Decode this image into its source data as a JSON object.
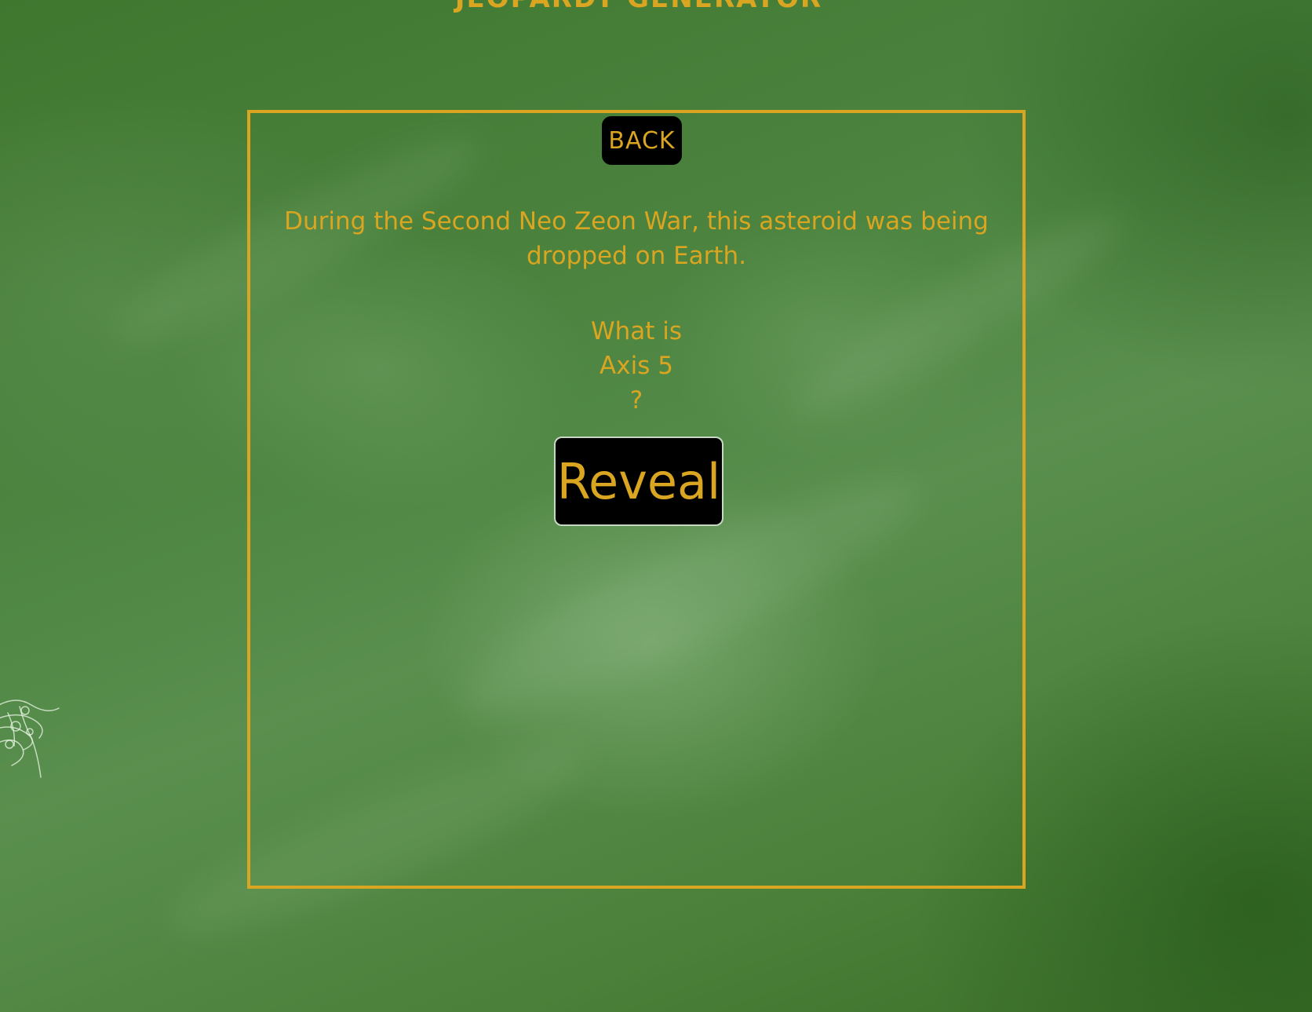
{
  "header": {
    "title": "JEOPARDY GENERATOR"
  },
  "board": {
    "back_label": "BACK",
    "clue": "During the Second Neo Zeon War, this asteroid was being dropped on Earth.",
    "answer": {
      "prefix": "What is",
      "value": "Axis 5",
      "suffix": "?"
    },
    "reveal_label": "Reveal"
  },
  "colors": {
    "accent": "#daa520",
    "button_bg": "#000000",
    "chalkboard": "#4c8440"
  }
}
